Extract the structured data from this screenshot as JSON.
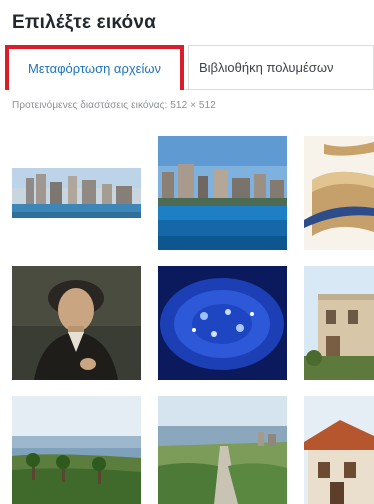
{
  "dialog": {
    "title": "Επιλέξτε εικόνα"
  },
  "tabs": [
    {
      "label": "Μεταφόρτωση αρχείων",
      "active": true
    },
    {
      "label": "Βιβλιοθήκη πολυμέσων",
      "active": false
    }
  ],
  "hint": "Προτεινόμενες διαστάσεις εικόνας: 512 × 512",
  "colors": {
    "highlight": "#d91e2a",
    "active_tab_text": "#1e73be",
    "title_text": "#23282d",
    "hint_text": "#8c8f94"
  }
}
